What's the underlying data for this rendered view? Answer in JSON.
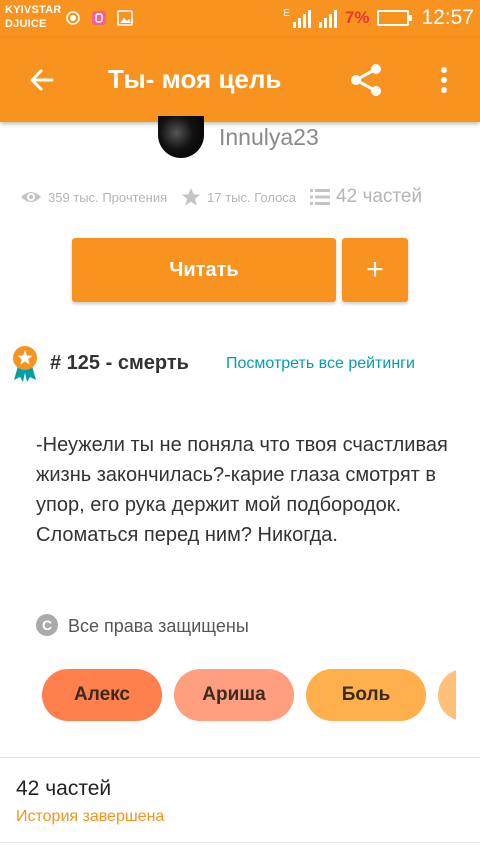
{
  "status_bar": {
    "carrier_line1": "KYIVSTAR",
    "carrier_line2": "DJUICE",
    "network_type": "E",
    "battery_percent": "7%",
    "time": "12:57"
  },
  "app_bar": {
    "title": "Ты- моя цель",
    "back_icon": "arrow-left-icon",
    "share_icon": "share-icon",
    "more_icon": "more-vertical-icon"
  },
  "story": {
    "author": "Innulya23",
    "stats": {
      "reads": "359 тыс. Прочтения",
      "votes": "17 тыс. Голоса",
      "parts": "42 частей"
    },
    "read_button": "Читать",
    "add_button": "+",
    "ranking": {
      "label": "# 125 - смерть",
      "link": "Посмотреть все рейтинги"
    },
    "description": "-Неужели ты не поняла что твоя счастливая жизнь закончилась?-карие глаза смотрят в упор,  его рука держит мой подбородок.  Сломаться перед ним? Никогда.",
    "copyright_symbol": "C",
    "copyright": "Все права защищены",
    "tags": [
      "Алекс",
      "Ариша",
      "Боль"
    ]
  },
  "parts_section": {
    "title": "42 частей",
    "status": "История завершена"
  },
  "colors": {
    "accent": "#f7931e",
    "link": "#00a0a8",
    "tag1": "#ff7f4d",
    "tag2": "#ff9f7f",
    "tag3": "#ffb04c",
    "tag4": "#ffc07a"
  }
}
